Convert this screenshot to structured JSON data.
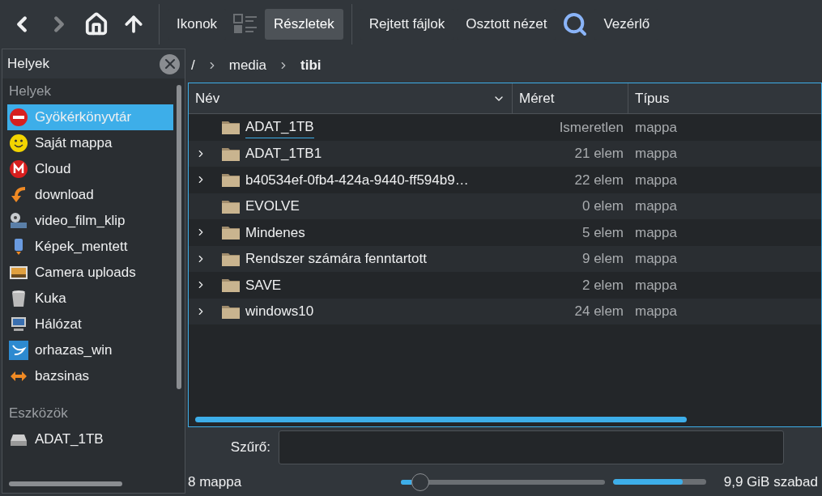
{
  "toolbar": [
    {
      "kind": "back",
      "disabled": false
    },
    {
      "kind": "forward",
      "disabled": true
    },
    {
      "kind": "home",
      "disabled": false
    },
    {
      "kind": "up",
      "disabled": false
    },
    {
      "kind": "separator"
    },
    {
      "kind": "text",
      "label": "Ikonok",
      "selected": false
    },
    {
      "kind": "compact"
    },
    {
      "kind": "text",
      "label": "Részletek",
      "selected": true
    },
    {
      "kind": "separator"
    },
    {
      "kind": "text",
      "label": "Rejtett fájlok",
      "selected": false
    },
    {
      "kind": "text",
      "label": "Osztott nézet",
      "selected": false
    },
    {
      "kind": "search"
    },
    {
      "kind": "text",
      "label": "Vezérlő",
      "selected": false
    }
  ],
  "places_panel": {
    "title": "Helyek",
    "sections": [
      {
        "heading": "Helyek",
        "items": [
          {
            "label": "Gyökérkönyvtár",
            "selected": true
          },
          {
            "label": "Saját mappa",
            "selected": false
          },
          {
            "label": "Cloud",
            "selected": false
          },
          {
            "label": "download",
            "selected": false
          },
          {
            "label": "video_film_klip",
            "selected": false
          },
          {
            "label": "Képek_mentett",
            "selected": false
          },
          {
            "label": "Camera uploads",
            "selected": false
          },
          {
            "label": "Kuka",
            "selected": false
          },
          {
            "label": "Hálózat",
            "selected": false
          },
          {
            "label": "orhazas_win",
            "selected": false
          },
          {
            "label": "bazsinas",
            "selected": false
          }
        ]
      },
      {
        "heading": "Eszközök",
        "items": [
          {
            "label": "ADAT_1TB",
            "selected": false
          }
        ]
      }
    ]
  },
  "breadcrumb": [
    {
      "label": "/",
      "current": false
    },
    {
      "label": "media",
      "current": false
    },
    {
      "label": "tibi",
      "current": true
    }
  ],
  "table": {
    "columns": [
      "Név",
      "Méret",
      "Típus"
    ],
    "rows": [
      {
        "name": "ADAT_1TB",
        "size": "Ismeretlen",
        "type": "mappa",
        "expandable": false,
        "focused": true
      },
      {
        "name": "ADAT_1TB1",
        "size": "21 elem",
        "type": "mappa",
        "expandable": true,
        "focused": false
      },
      {
        "name": "b40534ef-0fb4-424a-9440-ff594b9…",
        "size": "22 elem",
        "type": "mappa",
        "expandable": true,
        "focused": false
      },
      {
        "name": "EVOLVE",
        "size": "0 elem",
        "type": "mappa",
        "expandable": false,
        "focused": false
      },
      {
        "name": "Mindenes",
        "size": "5 elem",
        "type": "mappa",
        "expandable": true,
        "focused": false
      },
      {
        "name": "Rendszer számára fenntartott",
        "size": "9 elem",
        "type": "mappa",
        "expandable": true,
        "focused": false
      },
      {
        "name": "SAVE",
        "size": "2 elem",
        "type": "mappa",
        "expandable": true,
        "focused": false
      },
      {
        "name": "windows10",
        "size": "24 elem",
        "type": "mappa",
        "expandable": true,
        "focused": false
      }
    ]
  },
  "filter": {
    "label": "Szűrő:"
  },
  "status_bar": {
    "summary": "8 mappa",
    "zoom": {
      "level": 0.05
    },
    "disk": {
      "level": 0.75
    },
    "free": "9,9 GiB szabad"
  }
}
